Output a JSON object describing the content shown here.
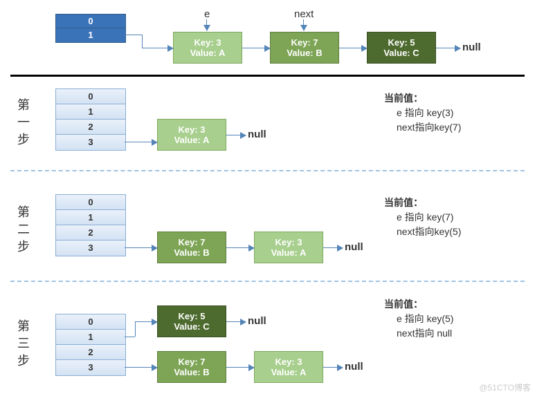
{
  "top": {
    "slots": [
      "0",
      "1"
    ],
    "e_label": "e",
    "next_label": "next",
    "nodes": [
      {
        "key": "Key: 3",
        "val": "Value: A"
      },
      {
        "key": "Key: 7",
        "val": "Value: B"
      },
      {
        "key": "Key: 5",
        "val": "Value: C"
      }
    ],
    "null": "null"
  },
  "steps": [
    {
      "title": {
        "c0": "第",
        "c1": "一",
        "c2": "步"
      },
      "slots": [
        "0",
        "1",
        "2",
        "3"
      ],
      "nodes": [
        {
          "key": "Key: 3",
          "val": "Value: A"
        }
      ],
      "nulls": [
        "null"
      ],
      "desc": {
        "title": "当前值：",
        "l1": "e 指向 key(3)",
        "l2": "next指向key(7)"
      }
    },
    {
      "title": {
        "c0": "第",
        "c1": "二",
        "c2": "步"
      },
      "slots": [
        "0",
        "1",
        "2",
        "3"
      ],
      "nodes": [
        {
          "key": "Key: 7",
          "val": "Value: B"
        },
        {
          "key": "Key: 3",
          "val": "Value: A"
        }
      ],
      "nulls": [
        "null"
      ],
      "desc": {
        "title": "当前值：",
        "l1": "e 指向 key(7)",
        "l2": "next指向key(5)"
      }
    },
    {
      "title": {
        "c0": "第",
        "c1": "三",
        "c2": "步"
      },
      "slots": [
        "0",
        "1",
        "2",
        "3"
      ],
      "row1": {
        "key": "Key: 5",
        "val": "Value: C"
      },
      "row2": [
        {
          "key": "Key: 7",
          "val": "Value: B"
        },
        {
          "key": "Key: 3",
          "val": "Value: A"
        }
      ],
      "nulls": [
        "null",
        "null"
      ],
      "desc": {
        "title": "当前值：",
        "l1": "e 指向 key(5)",
        "l2": "next指向 null"
      }
    }
  ],
  "watermark": "@51CTO博客"
}
